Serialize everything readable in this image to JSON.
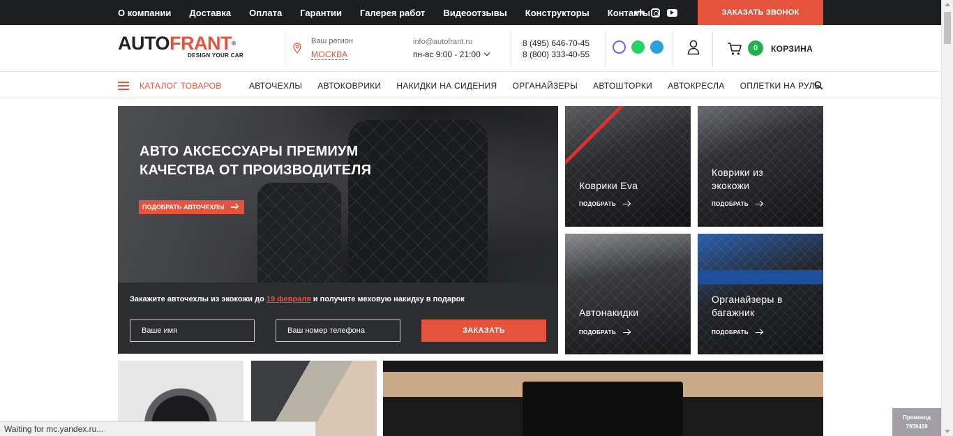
{
  "topbar": {
    "links": [
      "О компании",
      "Доставка",
      "Оплата",
      "Гарантии",
      "Галерея работ",
      "Видеоотзывы",
      "Конструкторы",
      "Контакты"
    ],
    "social": {
      "vk": "vk-icon",
      "instagram": "instagram-icon",
      "youtube": "youtube-icon"
    },
    "callback_label": "ЗАКАЗАТЬ ЗВОНОК"
  },
  "header": {
    "logo_main": "AUTO",
    "logo_accent": "FRANT",
    "logo_reg": "®",
    "logo_sub": "DESIGN YOUR CAR",
    "region_label": "Ваш регион",
    "region_city": "МОСКВА",
    "email": "info@autofrant.ru",
    "hours": "пн-вс 9:00 - 21:00",
    "phone_1": "8 (495) 646-70-45",
    "phone_2": "8 (800) 333-40-55",
    "cart_count": "0",
    "cart_label": "КОРЗИНА"
  },
  "catalog_nav": {
    "catalog_label": "КАТАЛОГ ТОВАРОВ",
    "items": [
      "АВТОЧЕХЛЫ",
      "АВТОКОВРИКИ",
      "НАКИДКИ НА СИДЕНИЯ",
      "ОРГАНАЙЗЕРЫ",
      "АВТОШТОРКИ",
      "АВТОКРЕСЛА",
      "ОПЛЕТКИ НА РУЛЬ"
    ]
  },
  "hero": {
    "title": "АВТО АКСЕССУАРЫ ПРЕМИУМ КАЧЕСТВА ОТ ПРОИЗВОДИТЕЛЯ",
    "button_label": "ПОДОБРАТЬ АВТОЧЕХЛЫ",
    "promo_before": "Закажите авточехлы из экокожи до ",
    "promo_date": "19 февраля",
    "promo_after": " и получите меховую накидку в подарок",
    "name_placeholder": "Ваше имя",
    "phone_placeholder": "Ваш номер телефона",
    "order_label": "ЗАКАЗАТЬ"
  },
  "tiles": [
    {
      "title": "Коврики Eva",
      "more": "ПОДОБРАТЬ"
    },
    {
      "title": "Коврики из экокожи",
      "more": "ПОДОБРАТЬ"
    },
    {
      "title": "Автонакидки",
      "more": "ПОДОБРАТЬ"
    },
    {
      "title": "Органайзеры в багажник",
      "more": "ПОДОБРАТЬ"
    }
  ],
  "status_text": "Waiting for mc.yandex.ru...",
  "promocode": {
    "label": "Промокод",
    "code": "7959469"
  },
  "colors": {
    "accent": "#e5533d",
    "dark": "#1d1e21",
    "cart_badge": "#20b24a"
  }
}
